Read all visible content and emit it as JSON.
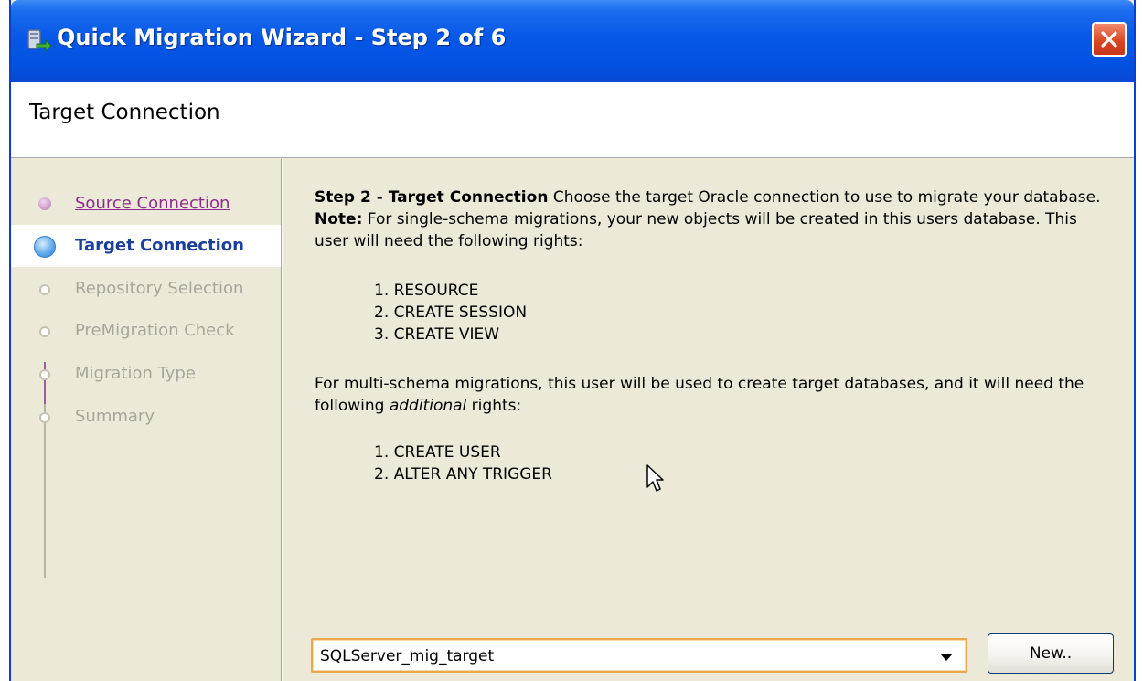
{
  "window": {
    "title": "Quick Migration Wizard - Step 2 of 6",
    "header": "Target Connection"
  },
  "steps": [
    {
      "label": "Source Connection",
      "state": "completed"
    },
    {
      "label": "Target Connection",
      "state": "current"
    },
    {
      "label": "Repository Selection",
      "state": "pending"
    },
    {
      "label": "PreMigration Check",
      "state": "pending"
    },
    {
      "label": "Migration Type",
      "state": "pending"
    },
    {
      "label": "Summary",
      "state": "pending"
    }
  ],
  "content": {
    "intro_heading": "Step 2 - Target Connection",
    "intro_text_1": " Choose the target Oracle connection to use to migrate your database. ",
    "note_label": "Note:",
    "intro_text_2": " For single-schema migrations, your new objects will be created in this users database. This user will need the following rights:",
    "rights": [
      "1. RESOURCE",
      "2. CREATE SESSION",
      "3. CREATE VIEW"
    ],
    "multi_text_1": "For multi-schema migrations, this user will be used to create target databases, and it will need the following ",
    "multi_emphasis": "additional",
    "multi_text_2": " rights:",
    "additional_rights": [
      "1. CREATE USER",
      "2. ALTER ANY TRIGGER"
    ]
  },
  "connection": {
    "selected": "SQLServer_mig_target",
    "new_button": "New.."
  },
  "colors": {
    "titlebar": "#0758e6",
    "current_step": "#1b3f9a",
    "completed_step": "#8c2d8c",
    "pending_step": "#a8a69b",
    "combo_border": "#e9a94a"
  }
}
